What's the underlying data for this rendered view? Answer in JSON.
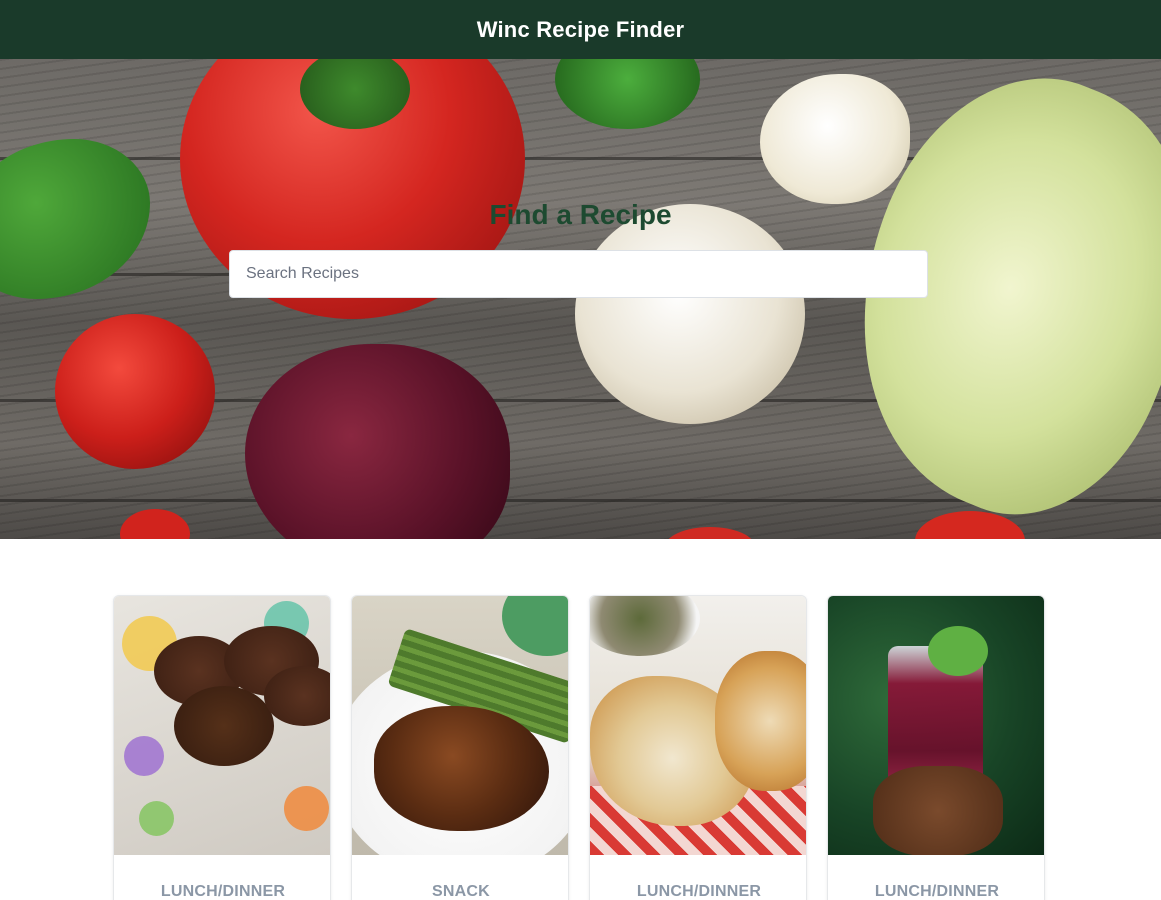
{
  "header": {
    "title": "Winc Recipe Finder"
  },
  "hero": {
    "title": "Find a Recipe",
    "search_placeholder": "Search Recipes"
  },
  "recipes": [
    {
      "category": "LUNCH/DINNER"
    },
    {
      "category": "SNACK"
    },
    {
      "category": "LUNCH/DINNER"
    },
    {
      "category": "LUNCH/DINNER"
    }
  ],
  "colors": {
    "header_bg": "#1a3a2a",
    "hero_title": "#1d4a30",
    "category_label": "#8b97a6"
  }
}
